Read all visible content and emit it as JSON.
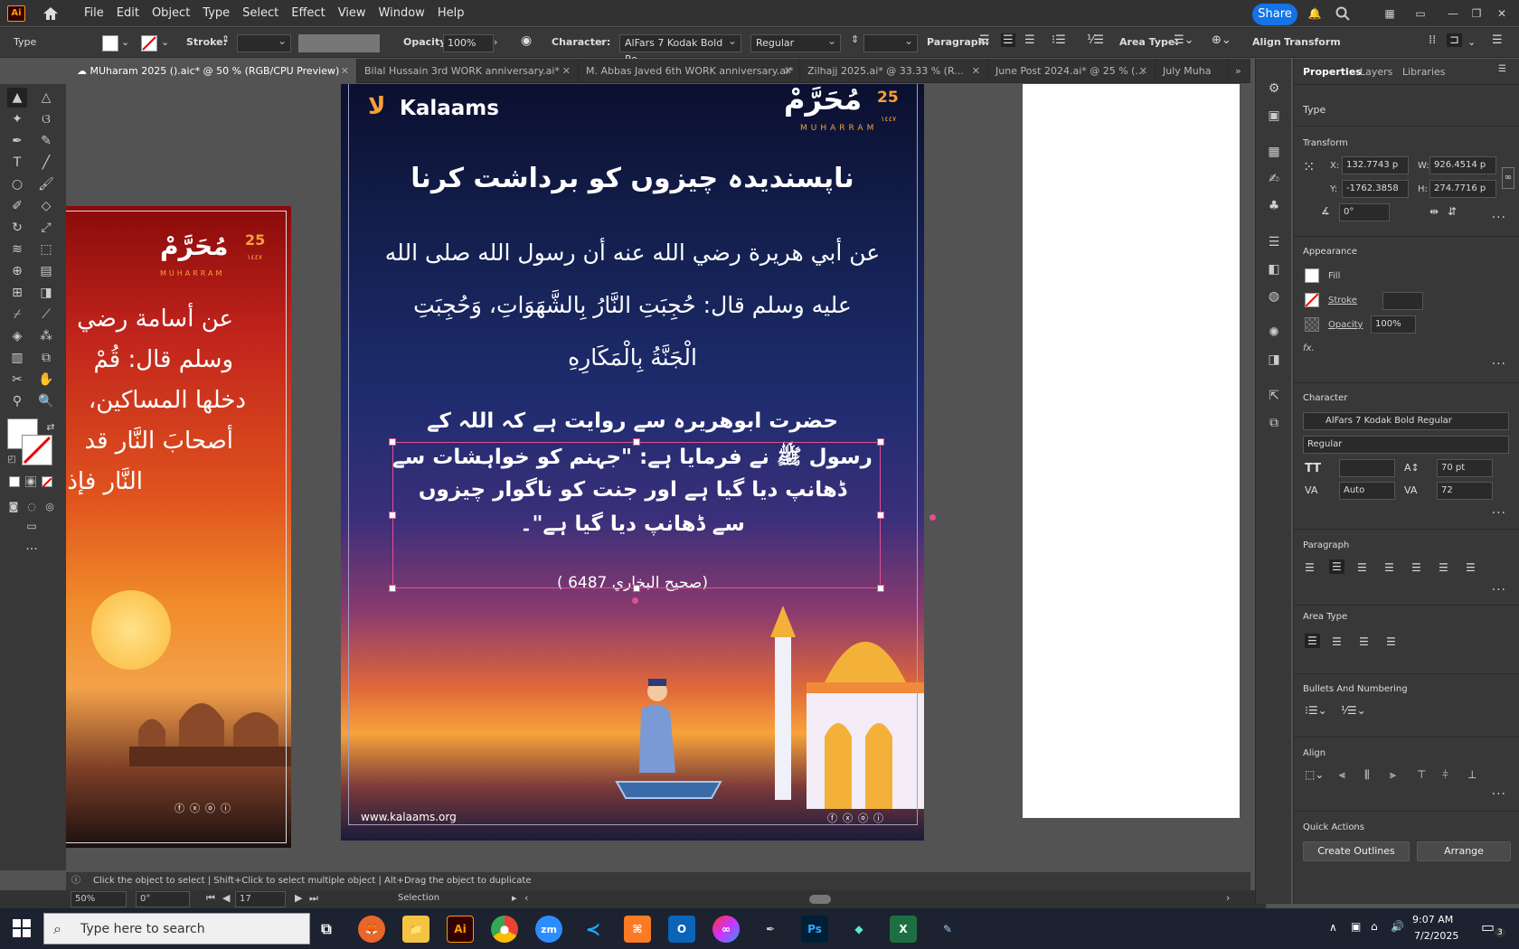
{
  "app": {
    "logo": "Ai",
    "share": "Share"
  },
  "menu": [
    "File",
    "Edit",
    "Object",
    "Type",
    "Select",
    "Effect",
    "View",
    "Window",
    "Help"
  ],
  "control": {
    "mode": "Type",
    "stroke_label": "Stroke:",
    "opacity_label": "Opacity:",
    "opacity": "100%",
    "character_label": "Character:",
    "font": "AlFars 7 Kodak Bold Re...",
    "style": "Regular",
    "paragraph_label": "Paragraph:",
    "area_type_label": "Area Type:",
    "align": "Align",
    "transform": "Transform"
  },
  "tabs": [
    {
      "label": "MUharam 2025 ().aic* @ 50 % (RGB/CPU Preview)",
      "active": true
    },
    {
      "label": "Bilal Hussain  3rd  WORK anniversary.ai*"
    },
    {
      "label": "M. Abbas Javed  6th  WORK anniversary.ai*"
    },
    {
      "label": "Zilhajj 2025.ai* @ 33.33 % (R..."
    },
    {
      "label": "June Post 2024.ai* @ 25 % (..."
    },
    {
      "label": "July Muha"
    }
  ],
  "artboard": {
    "brand": "Kalaams",
    "muharram_day": "25",
    "muharram_ar": "مُحَرَّمْ",
    "muharram_year": "١٤٤٧",
    "muharram_en": "MUHARRAM",
    "title": "ناپسندیدہ چیزوں کو برداشت کرنا",
    "arabic_l1": "عن أبي هريرة رضي الله عنه أن رسول الله صلى الله",
    "arabic_l2": "عليه وسلم قال: حُجِبَتِ النَّارُ بِالشَّهَوَاتِ، وَحُجِبَتِ",
    "arabic_l3": "الْجَنَّةُ بِالْمَكَارِهِ",
    "urdu_l1": "حضرت ابوهریرہ سے روایت ہے کہ اللہ کے",
    "urdu_l2": "رسول ﷺ نے فرمایا ہے: \"جہنم کو خواہشات سے",
    "urdu_l3": "ڈھانپ دیا گیا ہے اور جنت کو ناگوار چیزوں",
    "urdu_l4": "سے ڈھانپ دیا گیا ہے\"۔",
    "reference": "(صحيح البخاري 6487 )",
    "website": "www.kalaams.org"
  },
  "left_artboard": {
    "muharram_day": "25",
    "muharram_ar": "مُحَرَّمْ",
    "muharram_year": "١٤٤٧",
    "muharram_en": "MUHARRAM",
    "l1": "عن أسامة رضي",
    "l2": "وسلم قال: قُمْ",
    "l3": "دخلها المساكين،",
    "l4": "أصحابَ النَّار قد",
    "l5": "النَّار فإذ"
  },
  "panel": {
    "tabs": [
      "Properties",
      "Layers",
      "Libraries"
    ],
    "type": "Type",
    "transform": "Transform",
    "x_label": "X:",
    "x": "132.7743 p",
    "y_label": "Y:",
    "y": "-1762.3858",
    "w_label": "W:",
    "w": "926.4514 p",
    "h_label": "H:",
    "h": "274.7716 p",
    "angle": "0°",
    "appearance": "Appearance",
    "fill": "Fill",
    "stroke": "Stroke",
    "opacity_label": "Opacity",
    "opacity": "100%",
    "fx": "fx.",
    "character": "Character",
    "font": "AlFars 7 Kodak Bold Regular",
    "style": "Regular",
    "leading": "70 pt",
    "kerning": "Auto",
    "tracking": "72",
    "paragraph": "Paragraph",
    "area_type": "Area Type",
    "bullets": "Bullets And Numbering",
    "align": "Align",
    "quick_actions": "Quick Actions",
    "create_outlines": "Create Outlines",
    "arrange": "Arrange"
  },
  "status": {
    "hint": "Click the object to select  |  Shift+Click to select multiple object  |  Alt+Drag the object to duplicate"
  },
  "bottom": {
    "zoom": "50%",
    "angle": "0°",
    "artboard": "17",
    "tool": "Selection"
  },
  "taskbar": {
    "search": "Type here to search",
    "time": "9:07 AM",
    "date": "7/2/2025",
    "notif": "3"
  }
}
